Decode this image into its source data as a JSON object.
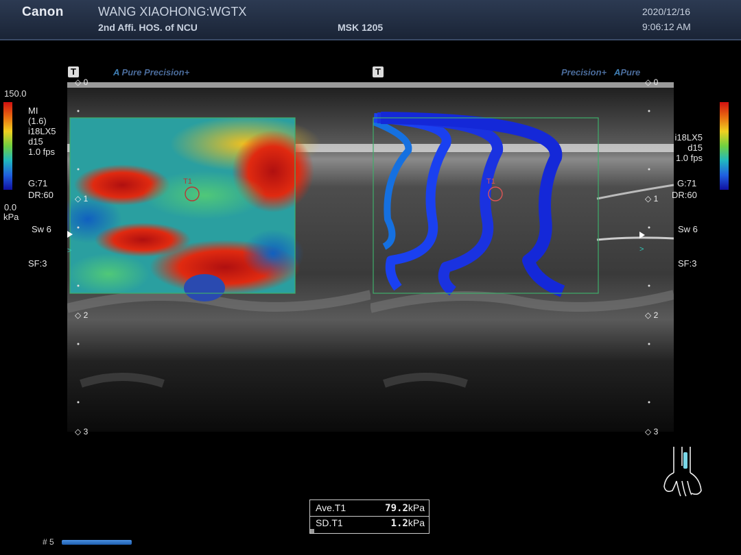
{
  "header": {
    "brand": "Canon",
    "patient": "WANG XIAOHONG:WGTX",
    "hospital": "2nd Affi. HOS. of NCU",
    "preset": "MSK 1205",
    "date": "2020/12/16",
    "time": "9:06:12 AM"
  },
  "left_panel": {
    "t_marker": "T",
    "mode_a": "A",
    "mode_label": "Pure Precision+",
    "scale_max": "150.0",
    "scale_min": "0.0",
    "scale_unit": "kPa",
    "params": [
      "MI",
      "(1.6)",
      "i18LX5",
      "d15",
      "1.0 fps"
    ],
    "gain": "G:71",
    "dr": "DR:60",
    "sweep": "Sw 6",
    "sf": "SF:3",
    "roi_label": "T1"
  },
  "right_panel": {
    "t_marker": "T",
    "mode_label": "Precision+",
    "mode_a": "A",
    "mode_label2": "Pure",
    "params": [
      "i18LX5",
      "d15",
      "1.0 fps"
    ],
    "gain": "G:71",
    "dr": "DR:60",
    "sweep": "Sw 6",
    "sf": "SF:3",
    "roi_label": "T1"
  },
  "depth_ticks": [
    "0",
    "1",
    "2",
    "3"
  ],
  "measurement": {
    "ave_label": "Ave.T1",
    "ave_value": "79.2",
    "ave_unit": "kPa",
    "sd_label": "SD.T1",
    "sd_value": "1.2",
    "sd_unit": "kPa"
  },
  "frame": {
    "label": "# 5"
  },
  "icons": {
    "body_mark": "hand-wrist-body-mark-icon",
    "probe": "probe-marker-icon"
  },
  "colors": {
    "roi_box": "#3fae6a",
    "header_bg": "#22304a",
    "propagation": "#1a3cf0"
  }
}
